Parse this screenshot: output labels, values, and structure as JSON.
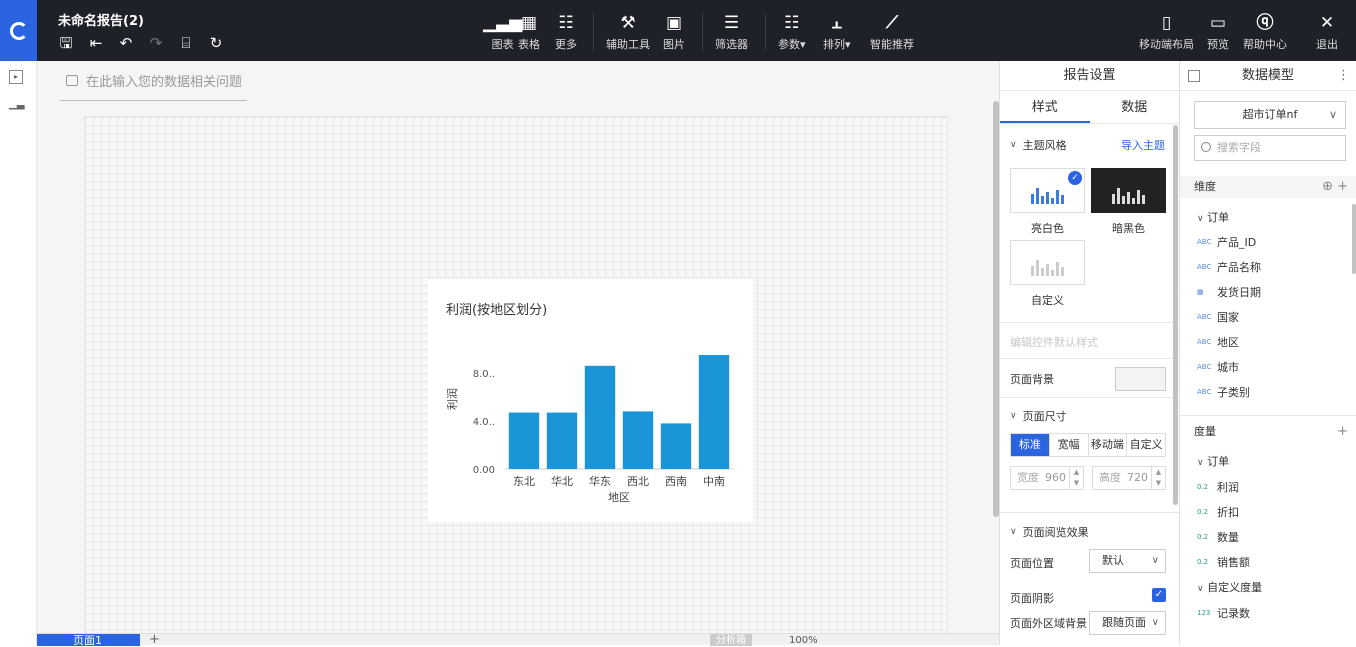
{
  "app": {
    "report_title": "未命名报告(2)",
    "quick_tools": [
      "save-icon",
      "back-icon",
      "undo-icon",
      "redo-icon",
      "format-painter-icon",
      "refresh-icon"
    ]
  },
  "toolbar": {
    "chart": "图表",
    "table": "表格",
    "more": "更多",
    "aux_tools": "辅助工具",
    "image": "图片",
    "filter": "筛选器",
    "params": "参数▾",
    "sort": "排列▾",
    "smart": "智能推荐",
    "mobile_layout": "移动端布局",
    "preview": "预览",
    "help": "帮助中心",
    "exit": "退出"
  },
  "canvas": {
    "ask_placeholder": "在此输入您的数据相关问题"
  },
  "chart_data": {
    "type": "bar",
    "title": "利润(按地区划分)",
    "xlabel": "地区",
    "ylabel": "利润",
    "categories": [
      "东北",
      "华北",
      "华东",
      "西北",
      "西南",
      "中南"
    ],
    "values": [
      4.7,
      4.7,
      8.6,
      4.8,
      3.8,
      9.5
    ],
    "yticks": [
      "0.00",
      "4.0..",
      "8.0.."
    ],
    "ylim": [
      0,
      10
    ],
    "color": "#1a96d8",
    "grid": false
  },
  "statusbar": {
    "page_tab": "页面1",
    "add": "+",
    "analysis": "分析箱",
    "zoom": "100%"
  },
  "settings": {
    "title": "报告设置",
    "tabs": [
      "样式",
      "数据"
    ],
    "theme_section": "主题风格",
    "import_theme": "导入主题",
    "themes": [
      "亮白色",
      "暗黑色",
      "自定义"
    ],
    "edit_default": "编辑控件默认样式",
    "page_bg": "页面背景",
    "page_size": "页面尺寸",
    "size_tabs": [
      "标准",
      "宽幅",
      "移动端",
      "自定义"
    ],
    "width_label": "宽度",
    "width_value": "960",
    "height_label": "高度",
    "height_value": "720",
    "view_effect": "页面阅览效果",
    "page_pos": "页面位置",
    "page_pos_value": "默认",
    "page_shadow": "页面阴影",
    "outer_bg": "页面外区域背景",
    "outer_bg_value": "跟随页面"
  },
  "model": {
    "title": "数据模型",
    "dataset": "超市订单nf",
    "search_placeholder": "搜索字段",
    "dimensions_label": "维度",
    "dim_folder": "订单",
    "dim_fields": [
      {
        "type": "ABC",
        "name": "产品_ID"
      },
      {
        "type": "ABC",
        "name": "产品名称"
      },
      {
        "type": "DATE",
        "name": "发货日期"
      },
      {
        "type": "ABC",
        "name": "国家"
      },
      {
        "type": "ABC",
        "name": "地区"
      },
      {
        "type": "ABC",
        "name": "城市"
      },
      {
        "type": "ABC",
        "name": "子类别"
      }
    ],
    "measures_label": "度量",
    "mea_folder": "订单",
    "mea_fields": [
      {
        "type": "0.2",
        "name": "利润"
      },
      {
        "type": "0.2",
        "name": "折扣"
      },
      {
        "type": "0.2",
        "name": "数量"
      },
      {
        "type": "0.2",
        "name": "销售额"
      }
    ],
    "custom_folder": "自定义度量",
    "custom_fields": [
      {
        "type": "123",
        "name": "记录数"
      }
    ]
  }
}
